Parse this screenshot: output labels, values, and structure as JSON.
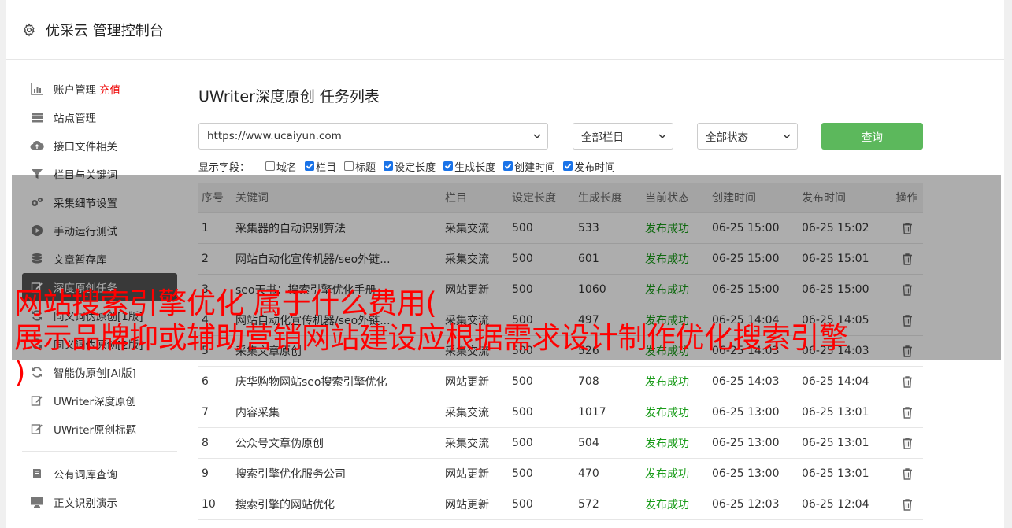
{
  "header": {
    "title": "优采云 管理控制台"
  },
  "sidebar": {
    "group1": [
      {
        "label": "账户管理",
        "badge": "充值",
        "icon": "bar-chart-icon"
      },
      {
        "label": "站点管理",
        "icon": "server-icon"
      },
      {
        "label": "接口文件相关",
        "icon": "cloud-upload-icon"
      },
      {
        "label": "栏目与关键词",
        "icon": "filter-icon"
      },
      {
        "label": "采集细节设置",
        "icon": "gears-icon"
      },
      {
        "label": "手动运行测试",
        "icon": "play-circle-icon"
      },
      {
        "label": "文章暂存库",
        "icon": "database-icon"
      },
      {
        "label": "深度原创任务",
        "icon": "edit-icon",
        "active": true
      },
      {
        "label": "同义词伪原创[1版]",
        "icon": "refresh-icon"
      },
      {
        "label": "同义词伪原创[2版]",
        "icon": "refresh-icon"
      },
      {
        "label": "智能伪原创[AI版]",
        "icon": "refresh-icon"
      },
      {
        "label": "UWriter深度原创",
        "icon": "edit-icon"
      },
      {
        "label": "UWriter原创标题",
        "icon": "edit-icon"
      }
    ],
    "group2": [
      {
        "label": "公有词库查询",
        "icon": "book-icon"
      },
      {
        "label": "正文识别演示",
        "icon": "monitor-icon"
      }
    ]
  },
  "main": {
    "title": "UWriter深度原创 任务列表",
    "filters": {
      "site": "https://www.ucaiyun.com",
      "column": "全部栏目",
      "status": "全部状态",
      "query_label": "查询"
    },
    "fields": {
      "label": "显示字段：",
      "items": [
        {
          "label": "域名",
          "checked": false
        },
        {
          "label": "栏目",
          "checked": true
        },
        {
          "label": "标题",
          "checked": false
        },
        {
          "label": "设定长度",
          "checked": true
        },
        {
          "label": "生成长度",
          "checked": true
        },
        {
          "label": "创建时间",
          "checked": true
        },
        {
          "label": "发布时间",
          "checked": true
        }
      ]
    },
    "table": {
      "headers": [
        "序号",
        "关键词",
        "栏目",
        "设定长度",
        "生成长度",
        "当前状态",
        "创建时间",
        "发布时间",
        "操作"
      ],
      "rows": [
        [
          "1",
          "采集器的自动识别算法",
          "采集交流",
          "500",
          "533",
          "发布成功",
          "06-25 15:00",
          "06-25 15:02"
        ],
        [
          "2",
          "网站自动化宣传机器/seo外链...",
          "采集交流",
          "500",
          "601",
          "发布成功",
          "06-25 15:00",
          "06-25 15:01"
        ],
        [
          "3",
          "seo天书：搜索引擎优化手册",
          "网站更新",
          "500",
          "1060",
          "发布成功",
          "06-25 15:00",
          "06-25 15:00"
        ],
        [
          "4",
          "网站自动化宣传机器/seo外链...",
          "采集交流",
          "500",
          "497",
          "发布成功",
          "06-25 14:04",
          "06-25 14:05"
        ],
        [
          "5",
          "采集文章原创",
          "采集交流",
          "500",
          "526",
          "发布成功",
          "06-25 14:03",
          "06-25 14:03"
        ],
        [
          "6",
          "庆华购物网站seo搜索引擎优化",
          "网站更新",
          "500",
          "708",
          "发布成功",
          "06-25 14:03",
          "06-25 14:04"
        ],
        [
          "7",
          "内容采集",
          "采集交流",
          "500",
          "1017",
          "发布成功",
          "06-25 13:00",
          "06-25 13:01"
        ],
        [
          "8",
          "公众号文章伪原创",
          "采集交流",
          "500",
          "504",
          "发布成功",
          "06-25 13:00",
          "06-25 13:01"
        ],
        [
          "9",
          "搜索引擎优化服务公司",
          "网站更新",
          "500",
          "470",
          "发布成功",
          "06-25 13:00",
          "06-25 13:01"
        ],
        [
          "10",
          "搜索引擎的网站优化",
          "网站更新",
          "500",
          "572",
          "发布成功",
          "06-25 12:03",
          "06-25 12:04"
        ]
      ]
    }
  },
  "caption": {
    "line1": "网站搜索引擎优化 属于什么费用(",
    "line2": "展示品牌抑或辅助营销网站建设应根据需求设计制作优化搜索引擎",
    "line3": ")"
  },
  "colors": {
    "accent_green": "#5cb85c",
    "success_text": "#1a9c1a",
    "caption_red": "#ff0000",
    "active_nav": "#555555"
  }
}
